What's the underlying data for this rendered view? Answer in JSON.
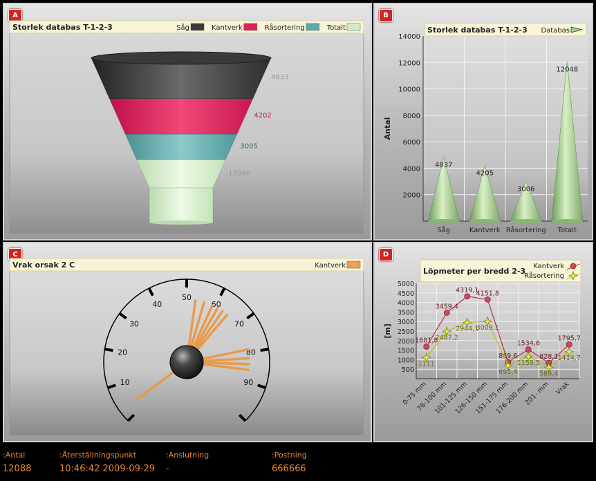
{
  "panels": {
    "a": {
      "badge": "A"
    },
    "b": {
      "badge": "B"
    },
    "c": {
      "badge": "C"
    },
    "d": {
      "badge": "D"
    }
  },
  "chart_data": [
    {
      "type": "funnel",
      "title": "Storlek databas T-1-2-3",
      "legend": [
        {
          "name": "Såg",
          "color": "#3a3a3a"
        },
        {
          "name": "Kantverk",
          "color": "#e0205a"
        },
        {
          "name": "Råsortering",
          "color": "#5ea8a8"
        },
        {
          "name": "Totalt",
          "color": "#d4ecc8"
        }
      ],
      "legend_position": "top-right",
      "categories": [
        "Såg",
        "Kantverk",
        "Råsortering",
        "Totalt"
      ],
      "values": [
        4833,
        4202,
        3005,
        12040
      ],
      "labels": [
        "4833",
        "4202",
        "3005",
        "12040"
      ],
      "label_colors": [
        "#9a9a9a",
        "#c0204a",
        "#3f6e6e",
        "#9a9a9a"
      ]
    },
    {
      "type": "bar",
      "title": "Storlek databas T-1-2-3",
      "legend": [
        {
          "name": "Databas",
          "color": "#a8cc8c"
        }
      ],
      "legend_position": "top-right",
      "ylabel": "Antal",
      "xlabel": "",
      "categories": [
        "Såg",
        "Kantverk",
        "Råsortering",
        "Totalt"
      ],
      "values": [
        4837,
        4205,
        3006,
        12048
      ],
      "labels": [
        "4837",
        "4205",
        "3006",
        "12048"
      ],
      "ylim": [
        0,
        14000
      ],
      "yticks": [
        2000,
        4000,
        6000,
        8000,
        10000,
        12000,
        14000
      ],
      "ytick_labels": [
        "2000",
        "4000",
        "6000",
        "8000",
        "10000",
        "12000",
        "14000"
      ],
      "grid": true
    },
    {
      "type": "gauge",
      "title": "Vrak orsak 2 C",
      "legend": [
        {
          "name": "Kantverk",
          "color": "#f0a050"
        }
      ],
      "legend_position": "top-right",
      "scale": [
        0,
        100
      ],
      "tick_labels": [
        {
          "value": 10,
          "text": "10"
        },
        {
          "value": 20,
          "text": "20"
        },
        {
          "value": 30,
          "text": "30"
        },
        {
          "value": 40,
          "text": "40"
        },
        {
          "value": 50,
          "text": "50"
        },
        {
          "value": 60,
          "text": "60"
        },
        {
          "value": 70,
          "text": "70"
        },
        {
          "value": 80,
          "text": "80"
        },
        {
          "value": 90,
          "text": "90"
        }
      ],
      "needles": [
        3,
        53,
        56,
        59,
        61,
        63,
        65,
        79,
        82,
        84,
        86
      ]
    },
    {
      "type": "line",
      "title": "Löpmeter per bredd 2-3",
      "ylabel": "[m]",
      "xlabel": "",
      "categories": [
        "0-75 mm",
        "76-100 mm",
        "101-125 mm",
        "126-150 mm",
        "151-175 mm",
        "176-200 mm",
        "201- mm",
        "Vrak"
      ],
      "ylim": [
        0,
        5000
      ],
      "yticks": [
        500,
        1000,
        1500,
        2000,
        2500,
        3000,
        3500,
        4000,
        4500,
        5000
      ],
      "ytick_labels": [
        "500",
        "1000",
        "1500",
        "2000",
        "2500",
        "3000",
        "3500",
        "4000",
        "4500",
        "5000"
      ],
      "legend_position": "top-right",
      "series": [
        {
          "name": "Kantverk",
          "color": "#c03048",
          "marker": "circle",
          "values": [
            1681.8,
            3459.4,
            4319.1,
            4151.8,
            869.6,
            1534.6,
            828.1,
            1795.7
          ],
          "labels": [
            "1681,8",
            "3459,4",
            "4319,1",
            "4151,8",
            "869,6",
            "1534,6",
            "828,1",
            "1795,7"
          ]
        },
        {
          "name": "Råsortering",
          "color": "#b8c020",
          "marker": "star",
          "values": [
            1111,
            2487.2,
            2944.1,
            3009.1,
            695.4,
            1159.5,
            589.4,
            1414.7
          ],
          "labels": [
            "1111",
            "2487,2",
            "2944,1",
            "3009,1",
            "695,4",
            "1159,5",
            "589,4",
            "1414,7"
          ]
        }
      ],
      "grid": true
    }
  ],
  "footer": {
    "antal_label": ":Antal",
    "antal_value": "12088",
    "reset_label": ":Återställningspunkt",
    "reset_value": "10:46:42 2009-09-29",
    "conn_label": ":Anslutning",
    "conn_value": "-",
    "post_label": ":Postning",
    "post_value": "666666"
  }
}
